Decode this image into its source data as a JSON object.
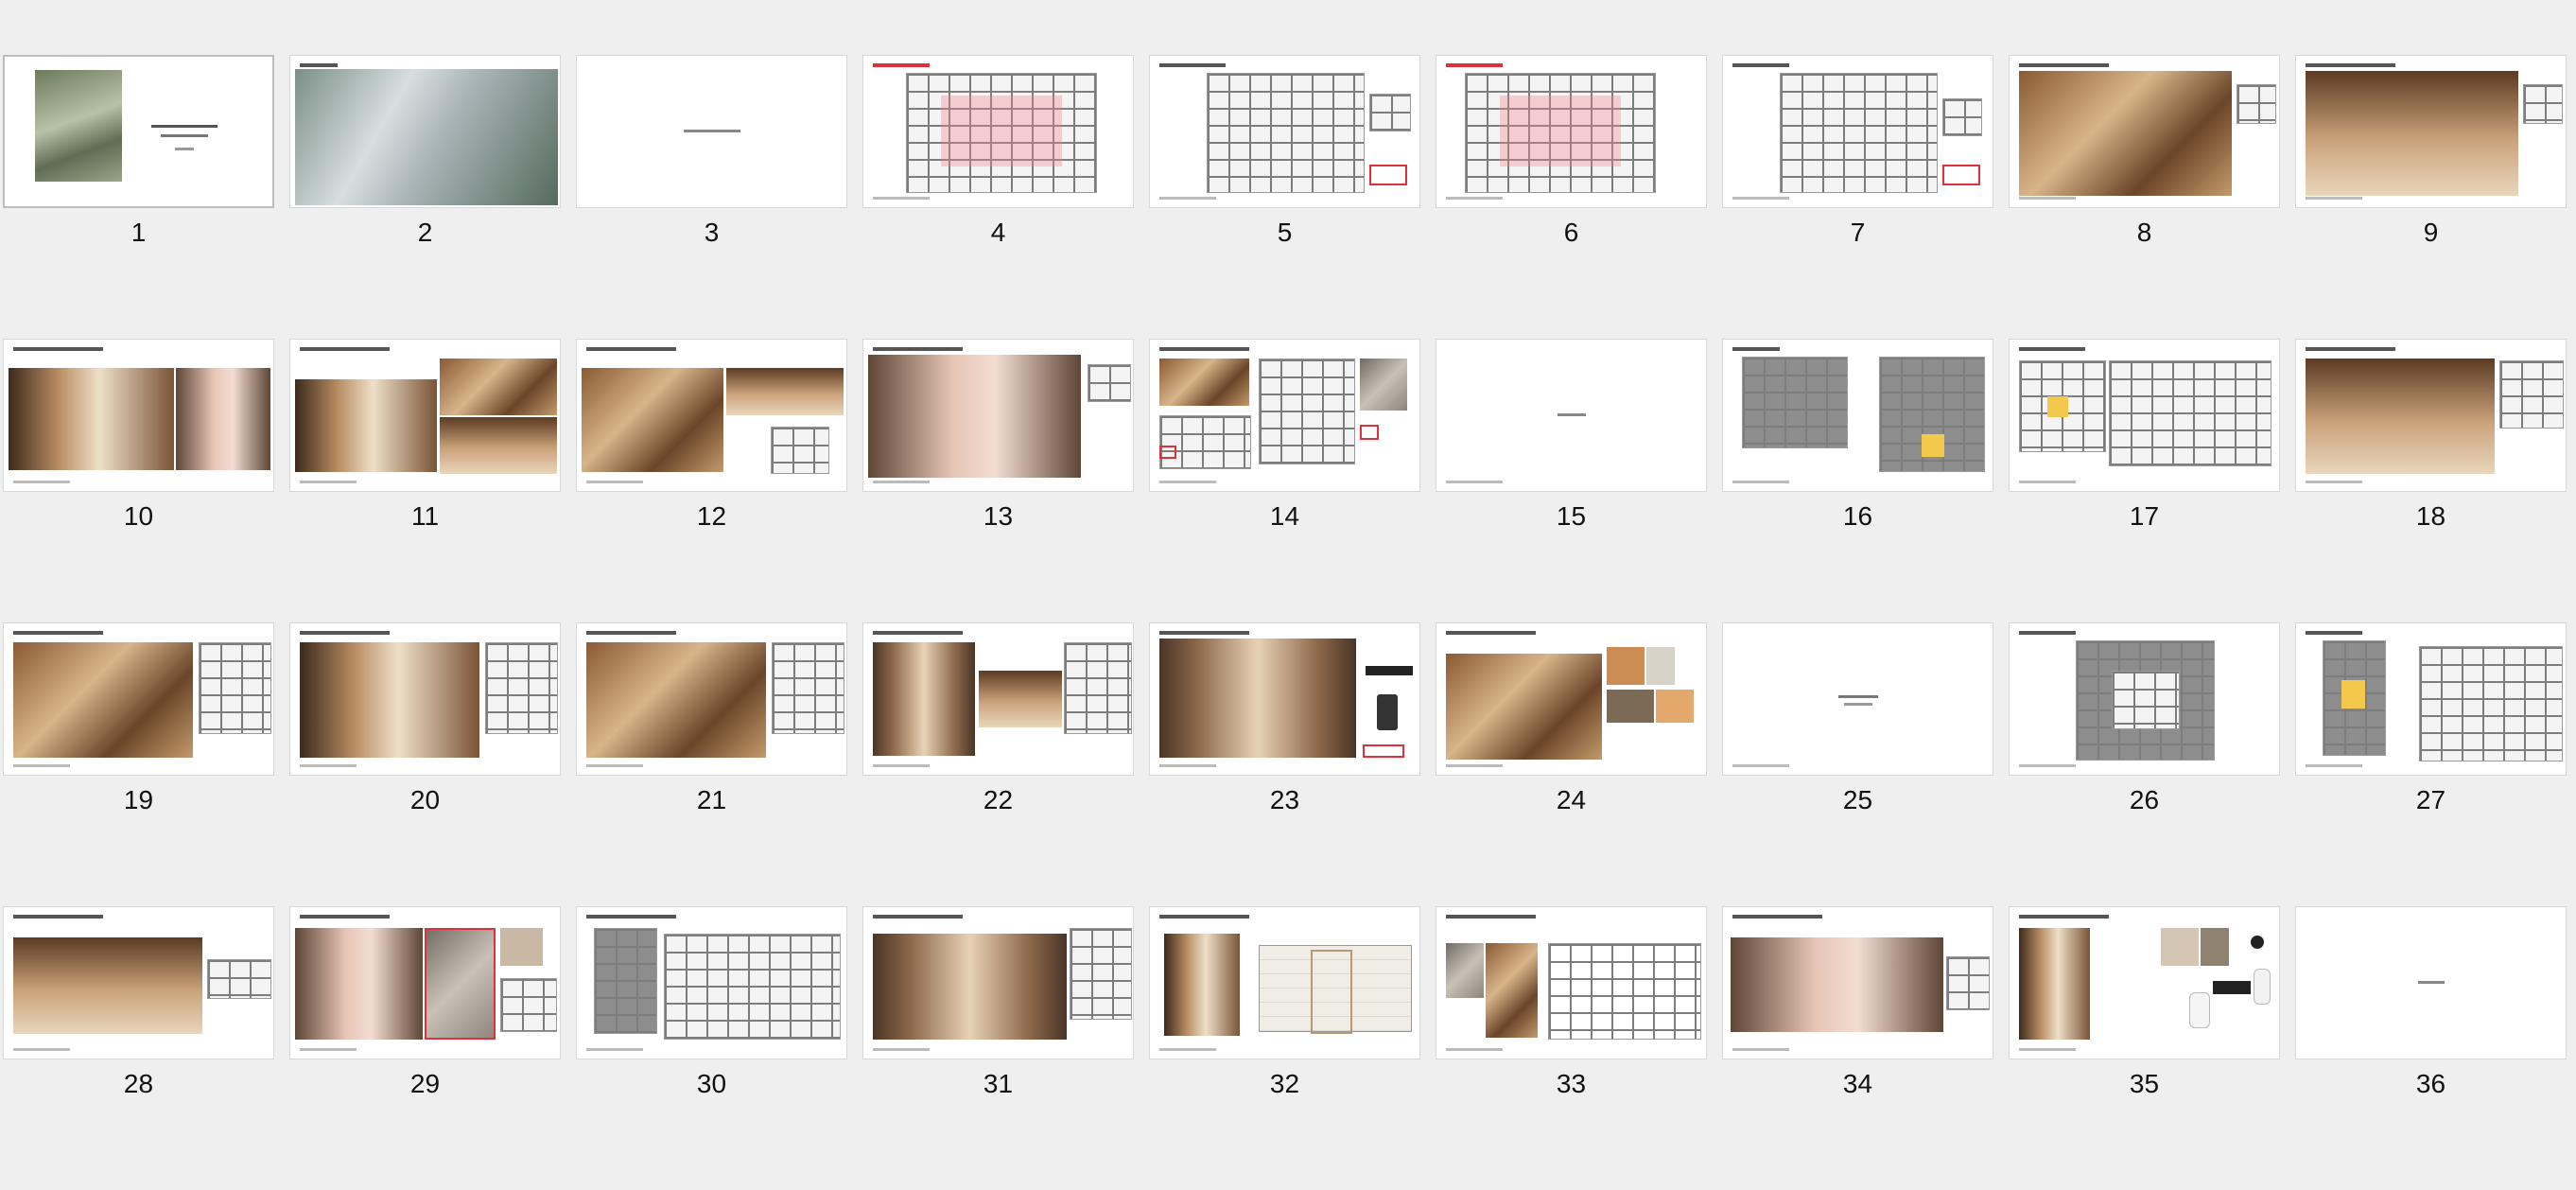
{
  "slides": [
    {
      "number": "1"
    },
    {
      "number": "2"
    },
    {
      "number": "3"
    },
    {
      "number": "4"
    },
    {
      "number": "5"
    },
    {
      "number": "6"
    },
    {
      "number": "7"
    },
    {
      "number": "8"
    },
    {
      "number": "9"
    },
    {
      "number": "10"
    },
    {
      "number": "11"
    },
    {
      "number": "12"
    },
    {
      "number": "13"
    },
    {
      "number": "14"
    },
    {
      "number": "15"
    },
    {
      "number": "16"
    },
    {
      "number": "17"
    },
    {
      "number": "18"
    },
    {
      "number": "19"
    },
    {
      "number": "20"
    },
    {
      "number": "21"
    },
    {
      "number": "22"
    },
    {
      "number": "23"
    },
    {
      "number": "24"
    },
    {
      "number": "25"
    },
    {
      "number": "26"
    },
    {
      "number": "27"
    },
    {
      "number": "28"
    },
    {
      "number": "29"
    },
    {
      "number": "30"
    },
    {
      "number": "31"
    },
    {
      "number": "32"
    },
    {
      "number": "33"
    },
    {
      "number": "34"
    },
    {
      "number": "35"
    },
    {
      "number": "36"
    }
  ],
  "selected_slide": "1",
  "colors": {
    "background": "#efefef",
    "accent_red": "#e0303b"
  }
}
